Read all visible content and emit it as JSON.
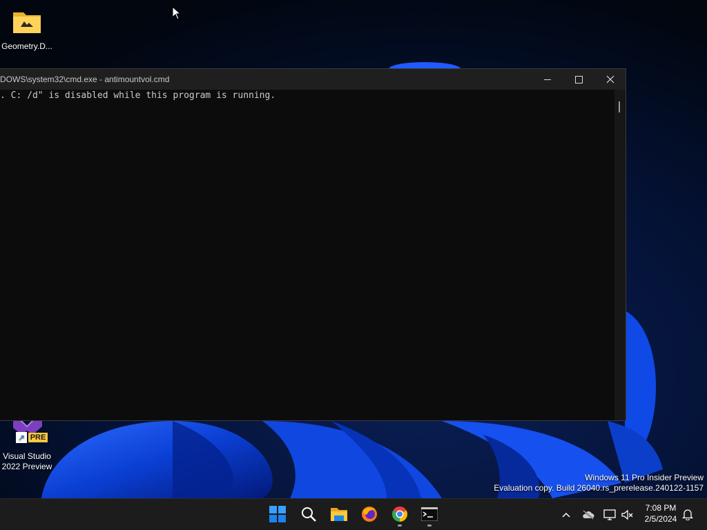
{
  "desktop": {
    "icons": [
      {
        "label": "Geometry.D...",
        "icon": "folder-icon"
      },
      {
        "label": "Visual Studio\n2022 Preview",
        "badge": "PRE",
        "icon": "visual-studio-icon"
      }
    ],
    "watermark": {
      "line1": "Windows 11 Pro Insider Preview",
      "line2": "Evaluation copy. Build 26040.rs_prerelease.240122-1157"
    }
  },
  "window": {
    "title": "DOWS\\system32\\cmd.exe - antimountvol.cmd",
    "console_text": ". C: /d\" is disabled while this program is running.",
    "buttons": {
      "minimize": "minimize-icon",
      "maximize": "maximize-icon",
      "close": "close-icon"
    }
  },
  "taskbar": {
    "apps": [
      {
        "name": "start",
        "icon": "windows-logo-icon"
      },
      {
        "name": "search",
        "icon": "search-icon"
      },
      {
        "name": "file-explorer",
        "icon": "folder-icon"
      },
      {
        "name": "firefox",
        "icon": "firefox-icon"
      },
      {
        "name": "chrome",
        "icon": "chrome-icon",
        "running": true
      },
      {
        "name": "terminal",
        "icon": "terminal-icon",
        "running": true
      }
    ],
    "tray": {
      "icons": [
        "chevron-up-icon",
        "cloud-offline-icon",
        "network-icon",
        "volume-muted-icon",
        "notification-bell-icon"
      ],
      "time": "7:08 PM",
      "date": "2/5/2024"
    }
  },
  "colors": {
    "accent": "#0a57d8",
    "console_bg": "#0c0c0c",
    "taskbar_bg": "#1c1c1c"
  }
}
